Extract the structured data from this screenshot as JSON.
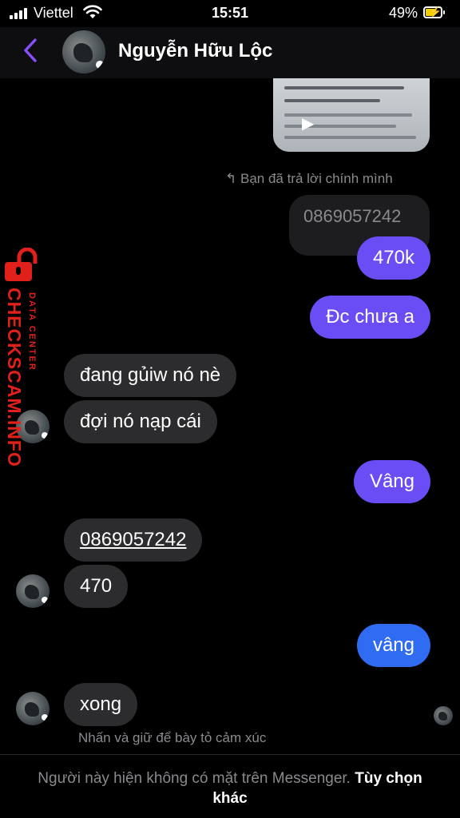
{
  "status_bar": {
    "carrier": "Viettel",
    "time": "15:51",
    "battery": "49%"
  },
  "header": {
    "contact_name": "Nguyễn Hữu Lộc"
  },
  "thread": {
    "reply_note": "Bạn đã trả lời chính mình",
    "quoted_message": "0869057242",
    "messages": [
      {
        "side": "out",
        "text": "470k"
      },
      {
        "side": "out",
        "text": "Đc chưa a"
      },
      {
        "side": "in",
        "text": "đang gủiw nó nè"
      },
      {
        "side": "in",
        "text": "đợi nó nạp cái"
      },
      {
        "side": "out",
        "text": "Vâng"
      },
      {
        "side": "in",
        "text": "0869057242"
      },
      {
        "side": "in",
        "text": "470"
      },
      {
        "side": "out",
        "text": "vâng"
      },
      {
        "side": "in",
        "text": "xong"
      }
    ],
    "reaction_hint": "Nhấn và giữ để bày tỏ cảm xúc"
  },
  "footer": {
    "notice": "Người này hiện không có mặt trên Messenger.",
    "link": "Tùy chọn khác"
  },
  "watermark": {
    "brand": "CHECKSCAM.INFO",
    "sub": "DATA CENTER"
  },
  "colors": {
    "purple_bubble": "#6a4df5",
    "blue_bubble": "#2f6cf2",
    "incoming_bubble": "#2c2c2e",
    "back_arrow": "#8a4dff",
    "watermark": "#e0201b"
  },
  "icons": [
    "signal-icon",
    "wifi-icon",
    "battery-charging-icon",
    "back-arrow-icon",
    "reply-arrow-icon",
    "play-icon",
    "lock-icon"
  ]
}
